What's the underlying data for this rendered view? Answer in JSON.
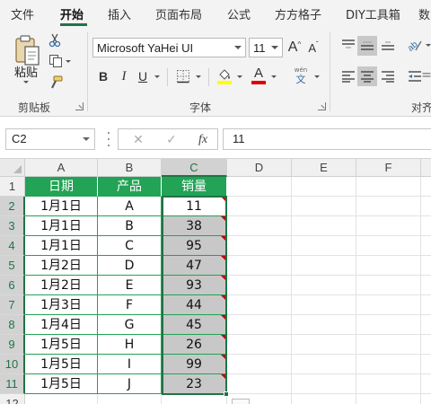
{
  "ribbon": {
    "tabs": [
      "文件",
      "开始",
      "插入",
      "页面布局",
      "公式",
      "方方格子",
      "DIY工具箱",
      "数"
    ],
    "active_tab": "开始",
    "clipboard": {
      "paste_label": "粘贴",
      "group_label": "剪贴板"
    },
    "font": {
      "font_name": "Microsoft YaHei UI",
      "font_size": "11",
      "bold": "B",
      "italic": "I",
      "underline": "U",
      "grow_font": "A",
      "shrink_font": "A",
      "font_color_glyph": "A",
      "phonetic_top": "wén",
      "phonetic_bottom": "文",
      "group_label": "字体",
      "highlight_color": "#ffff00",
      "font_color": "#e00000"
    },
    "alignment": {
      "group_label": "对齐"
    }
  },
  "formula_bar": {
    "name_box": "C2",
    "cancel_glyph": "✕",
    "enter_glyph": "✓",
    "fx_glyph": "fx",
    "formula": "11"
  },
  "sheet": {
    "columns": [
      "A",
      "B",
      "C",
      "D",
      "E",
      "F"
    ],
    "selected_column": "C",
    "rows": [
      "1",
      "2",
      "3",
      "4",
      "5",
      "6",
      "7",
      "8",
      "9",
      "10",
      "11",
      "12"
    ],
    "header": [
      "日期",
      "产品",
      "销量"
    ],
    "data": [
      [
        "1月1日",
        "A",
        "11"
      ],
      [
        "1月1日",
        "B",
        "38"
      ],
      [
        "1月1日",
        "C",
        "95"
      ],
      [
        "1月2日",
        "D",
        "47"
      ],
      [
        "1月2日",
        "E",
        "93"
      ],
      [
        "1月3日",
        "F",
        "44"
      ],
      [
        "1月4日",
        "G",
        "45"
      ],
      [
        "1月5日",
        "H",
        "26"
      ],
      [
        "1月5日",
        "I",
        "99"
      ],
      [
        "1月5日",
        "J",
        "23"
      ]
    ],
    "colors": {
      "header_fill": "#22a355",
      "selection": "#217346",
      "error_marker": "#c00000",
      "selected_fill": "#c8c8c8"
    }
  }
}
